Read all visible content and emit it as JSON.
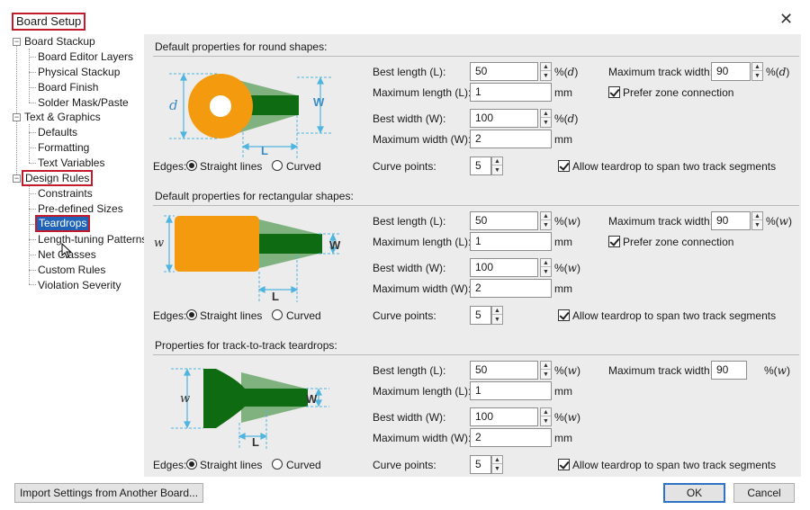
{
  "dialog": {
    "title": "Board Setup",
    "close_glyph": "✕"
  },
  "tree": {
    "items": [
      {
        "label": "Board Stackup",
        "level": 0,
        "toggle": "−"
      },
      {
        "label": "Board Editor Layers",
        "level": 1
      },
      {
        "label": "Physical Stackup",
        "level": 1
      },
      {
        "label": "Board Finish",
        "level": 1
      },
      {
        "label": "Solder Mask/Paste",
        "level": 1
      },
      {
        "label": "Text & Graphics",
        "level": 0,
        "toggle": "−"
      },
      {
        "label": "Defaults",
        "level": 1
      },
      {
        "label": "Formatting",
        "level": 1
      },
      {
        "label": "Text Variables",
        "level": 1
      },
      {
        "label": "Design Rules",
        "level": 0,
        "toggle": "−"
      },
      {
        "label": "Constraints",
        "level": 1
      },
      {
        "label": "Pre-defined Sizes",
        "level": 1
      },
      {
        "label": "Teardrops",
        "level": 1
      },
      {
        "label": "Length-tuning Patterns",
        "level": 1
      },
      {
        "label": "Net Classes",
        "level": 1
      },
      {
        "label": "Custom Rules",
        "level": 1
      },
      {
        "label": "Violation Severity",
        "level": 1
      }
    ]
  },
  "sections": [
    {
      "heading": "Default properties for round shapes:",
      "best_length_label": "Best length (L):",
      "best_length": "50",
      "best_length_unit": "%(",
      "best_length_var": "d",
      "max_length_label": "Maximum length (L):",
      "max_length": "1",
      "max_length_unit": "mm",
      "best_width_label": "Best width (W):",
      "best_width": "100",
      "best_width_unit": "%(",
      "best_width_var": "d",
      "max_width_label": "Maximum width (W):",
      "max_width": "2",
      "max_width_unit": "mm",
      "curve_label": "Curve points:",
      "curve": "5",
      "max_track_label": "Maximum track width:",
      "max_track": "90",
      "max_track_unit": "%(",
      "max_track_var": "d",
      "prefer_zone": "Prefer zone connection",
      "allow_span": "Allow teardrop to span two track segments",
      "edges_label": "Edges:",
      "straight": "Straight lines",
      "curved": "Curved",
      "diag": {
        "size_var": "d",
        "w": "W",
        "l": "L"
      }
    },
    {
      "heading": "Default properties for rectangular shapes:",
      "best_length_label": "Best length (L):",
      "best_length": "50",
      "best_length_unit": "%(",
      "best_length_var": "w",
      "max_length_label": "Maximum length (L):",
      "max_length": "1",
      "max_length_unit": "mm",
      "best_width_label": "Best width (W):",
      "best_width": "100",
      "best_width_unit": "%(",
      "best_width_var": "w",
      "max_width_label": "Maximum width (W):",
      "max_width": "2",
      "max_width_unit": "mm",
      "curve_label": "Curve points:",
      "curve": "5",
      "max_track_label": "Maximum track width:",
      "max_track": "90",
      "max_track_unit": "%(",
      "max_track_var": "w",
      "prefer_zone": "Prefer zone connection",
      "allow_span": "Allow teardrop to span two track segments",
      "edges_label": "Edges:",
      "straight": "Straight lines",
      "curved": "Curved",
      "diag": {
        "size_var": "w",
        "w": "W",
        "l": "L"
      }
    },
    {
      "heading": "Properties for track-to-track teardrops:",
      "best_length_label": "Best length (L):",
      "best_length": "50",
      "best_length_unit": "%(",
      "best_length_var": "w",
      "max_length_label": "Maximum length (L):",
      "max_length": "1",
      "max_length_unit": "mm",
      "best_width_label": "Best width (W):",
      "best_width": "100",
      "best_width_unit": "%(",
      "best_width_var": "w",
      "max_width_label": "Maximum width (W):",
      "max_width": "2",
      "max_width_unit": "mm",
      "curve_label": "Curve points:",
      "curve": "5",
      "max_track_label": "Maximum track width",
      "max_track": "90",
      "max_track_unit": "%(",
      "max_track_var": "w",
      "allow_span": "Allow teardrop to span two track segments",
      "edges_label": "Edges:",
      "straight": "Straight lines",
      "curved": "Curved",
      "diag": {
        "size_var": "w",
        "w": "W",
        "l": "L"
      }
    }
  ],
  "footer": {
    "import_label": "Import Settings from Another Board...",
    "ok_label": "OK",
    "cancel_label": "Cancel"
  },
  "colors": {
    "pad_orange": "#f39a0f",
    "track_green": "#0f6b12",
    "teardrop_light_green": "#7fb27f",
    "dimension_blue": "#4fb4e0",
    "highlight_red": "#c21c2c",
    "selection_blue": "#1e63b7"
  }
}
